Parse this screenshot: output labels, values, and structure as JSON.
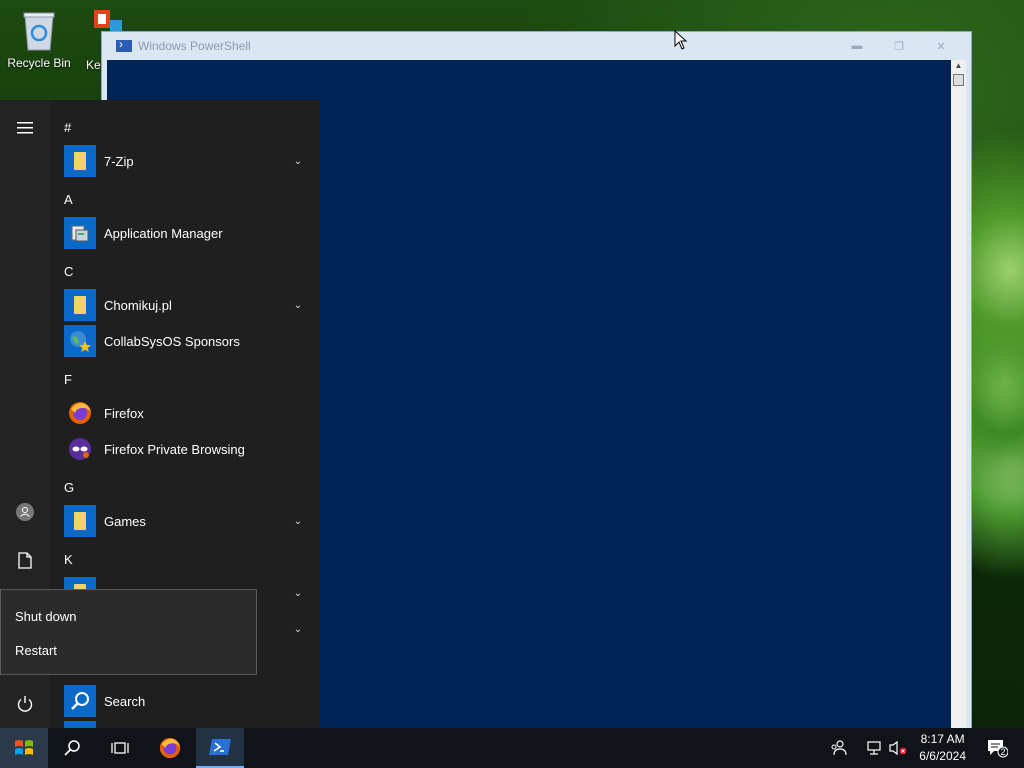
{
  "desktop": {
    "icons": [
      {
        "label": "Recycle Bin",
        "icon": "recycle-bin-icon"
      },
      {
        "label": "Ke",
        "icon": "app-shortcut-icon"
      }
    ]
  },
  "powershell": {
    "title": "Windows PowerShell",
    "buttons": [
      "minimize-icon",
      "restore-icon",
      "close-icon"
    ],
    "background": "#012456"
  },
  "start_menu": {
    "rail": [
      "hamburger-icon",
      "user-icon",
      "document-icon",
      "power-icon"
    ],
    "groups": [
      {
        "letter": "#",
        "apps": [
          {
            "name": "7-Zip",
            "icon": "folder-icon",
            "expandable": true
          }
        ]
      },
      {
        "letter": "A",
        "apps": [
          {
            "name": "Application Manager",
            "icon": "app-manager-icon",
            "expandable": false
          }
        ]
      },
      {
        "letter": "C",
        "apps": [
          {
            "name": "Chomikuj.pl",
            "icon": "folder-icon",
            "expandable": true
          },
          {
            "name": "CollabSysOS Sponsors",
            "icon": "globe-star-icon",
            "expandable": false
          }
        ]
      },
      {
        "letter": "F",
        "apps": [
          {
            "name": "Firefox",
            "icon": "firefox-icon",
            "expandable": false
          },
          {
            "name": "Firefox Private Browsing",
            "icon": "firefox-private-icon",
            "expandable": false
          }
        ]
      },
      {
        "letter": "G",
        "apps": [
          {
            "name": "Games",
            "icon": "folder-icon",
            "expandable": true
          }
        ]
      },
      {
        "letter": "K",
        "apps": []
      }
    ],
    "search_item": {
      "name": "Search",
      "icon": "search-icon"
    },
    "power_flyout": {
      "shutdown": "Shut down",
      "restart": "Restart"
    }
  },
  "taskbar": {
    "items": [
      "windows-start-icon",
      "search-icon",
      "task-view-icon",
      "firefox-icon",
      "powershell-icon"
    ],
    "clock": {
      "time": "8:17 AM",
      "date": "6/6/2024"
    },
    "notifications": "2",
    "accent": "#6fb2ff"
  }
}
